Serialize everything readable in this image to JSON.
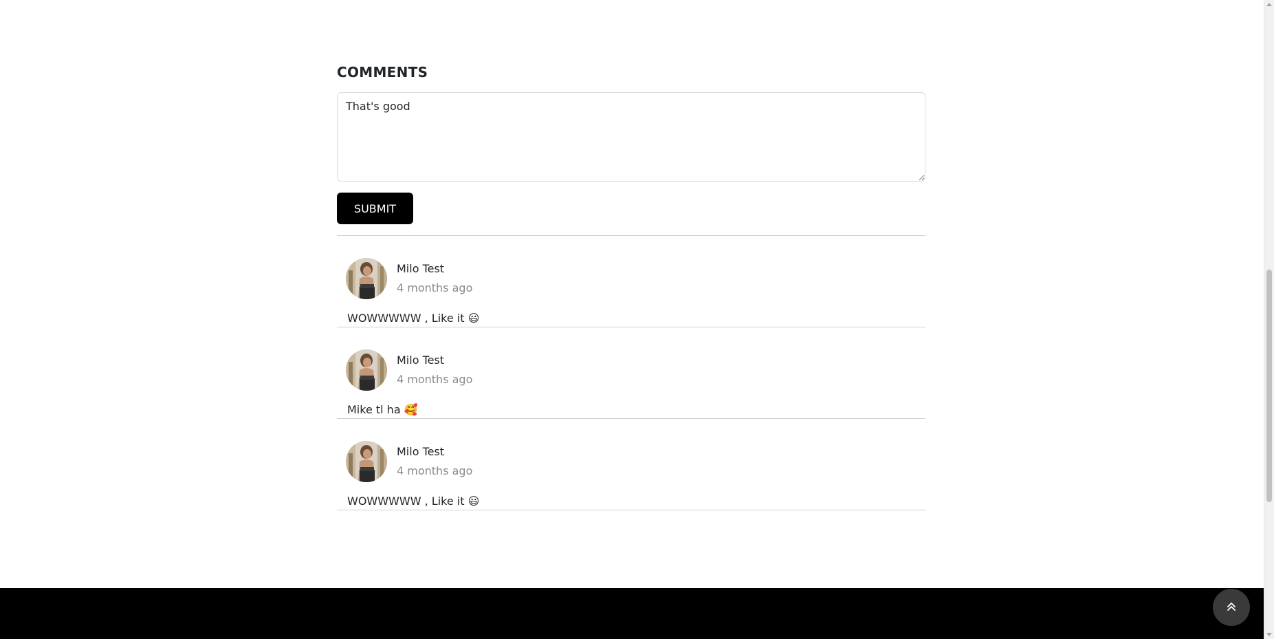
{
  "comments_section": {
    "title": "COMMENTS",
    "input_value": "That's good",
    "submit_label": "SUBMIT"
  },
  "comments": [
    {
      "author": "Milo Test",
      "time": "4 months ago",
      "text": "WOWWWWW , Like it 😃"
    },
    {
      "author": "Milo Test",
      "time": "4 months ago",
      "text": "Mike tl ha 🥰"
    },
    {
      "author": "Milo Test",
      "time": "4 months ago",
      "text": "WOWWWWW , Like it 😃"
    }
  ],
  "icons": {
    "back_to_top": "double-chevron-up-icon",
    "avatar": "user-photo"
  },
  "colors": {
    "button_bg": "#000000",
    "footer_bg": "#000000",
    "back_to_top_bg": "#3a3a3a",
    "timestamp": "#8a8a8a"
  }
}
